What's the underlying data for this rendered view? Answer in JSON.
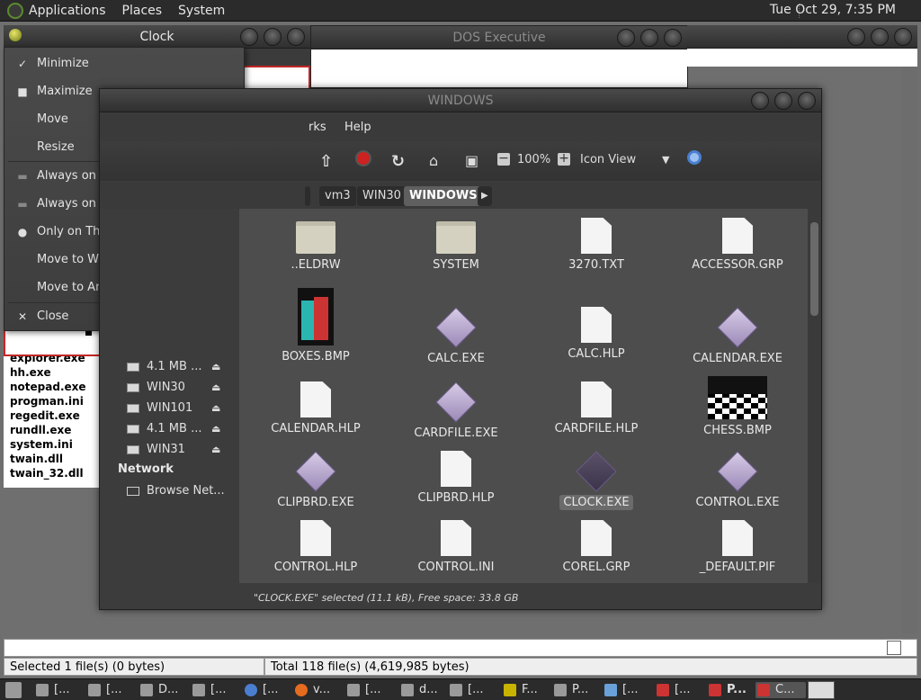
{
  "top_panel": {
    "menus": [
      "Applications",
      "Places",
      "System"
    ],
    "clock": "Tue Oct 29,  7:35 PM"
  },
  "dos_exec": {
    "title": "DOS Executive"
  },
  "clock_window": {
    "title": "Clock"
  },
  "window_menu": {
    "items": [
      {
        "label": "Minimize",
        "icon": "minimize-icon"
      },
      {
        "label": "Maximize",
        "icon": "maximize-icon"
      },
      {
        "label": "Move",
        "icon": ""
      },
      {
        "label": "Resize",
        "icon": ""
      },
      {
        "label": "Always on Top",
        "icon": "radio-off-icon"
      },
      {
        "label": "Always on Visible Workspace",
        "icon": "radio-off-icon"
      },
      {
        "label": "Only on This Workspace",
        "icon": "radio-on-icon"
      },
      {
        "label": "Move to Workspace Right",
        "icon": ""
      },
      {
        "label": "Move to Another Workspace",
        "icon": "submenu-arrow"
      },
      {
        "label": "Close",
        "icon": "close-icon"
      }
    ]
  },
  "dos_files": [
    "explorer.exe",
    "hh.exe",
    "notepad.exe",
    "progman.ini",
    "regedit.exe",
    "rundll.exe",
    "system.ini",
    "twain.dll",
    "twain_32.dll"
  ],
  "nautilus": {
    "title": "WINDOWS",
    "menu": [
      "rks",
      "Help"
    ],
    "zoom": "100%",
    "view_mode": "Icon View",
    "breadcrumbs": [
      "vm3",
      "WIN30",
      "WINDOWS"
    ],
    "sidebar": {
      "devices": [
        {
          "label": "4.1 MB ..."
        },
        {
          "label": "WIN30"
        },
        {
          "label": "WIN101"
        },
        {
          "label": "4.1 MB ..."
        },
        {
          "label": "WIN31"
        }
      ],
      "network_header": "Network",
      "network_items": [
        "Browse Net..."
      ]
    },
    "files": [
      {
        "name": "..ELDRW",
        "type": "folder"
      },
      {
        "name": "SYSTEM",
        "type": "folder"
      },
      {
        "name": "3270.TXT",
        "type": "doc"
      },
      {
        "name": "ACCESSOR.GRP",
        "type": "doc"
      },
      {
        "name": "BOXES.BMP",
        "type": "boxes"
      },
      {
        "name": "CALC.EXE",
        "type": "exe"
      },
      {
        "name": "CALC.HLP",
        "type": "doc"
      },
      {
        "name": "CALENDAR.EXE",
        "type": "exe"
      },
      {
        "name": "CALENDAR.HLP",
        "type": "doc"
      },
      {
        "name": "CARDFILE.EXE",
        "type": "exe"
      },
      {
        "name": "CARDFILE.HLP",
        "type": "doc"
      },
      {
        "name": "CHESS.BMP",
        "type": "chess"
      },
      {
        "name": "CLIPBRD.EXE",
        "type": "exe"
      },
      {
        "name": "CLIPBRD.HLP",
        "type": "doc"
      },
      {
        "name": "CLOCK.EXE",
        "type": "exe-sel"
      },
      {
        "name": "CONTROL.EXE",
        "type": "exe"
      },
      {
        "name": "CONTROL.HLP",
        "type": "doc"
      },
      {
        "name": "CONTROL.INI",
        "type": "doc"
      },
      {
        "name": "COREL.GRP",
        "type": "doc"
      },
      {
        "name": "_DEFAULT.PIF",
        "type": "doc"
      }
    ],
    "status": "\"CLOCK.EXE\" selected (11.1 kB), Free space: 33.8 GB"
  },
  "bottom_status": {
    "left": "Selected 1 file(s) (0 bytes)",
    "right": "Total 118 file(s) (4,619,985 bytes)"
  },
  "taskbar": {
    "tasks": [
      "[...",
      "[...",
      "D...",
      "[...",
      "[...",
      "v...",
      "[...",
      "d...",
      "[...",
      "F...",
      "P...",
      "[...",
      "[...",
      "P...",
      "C..."
    ]
  }
}
